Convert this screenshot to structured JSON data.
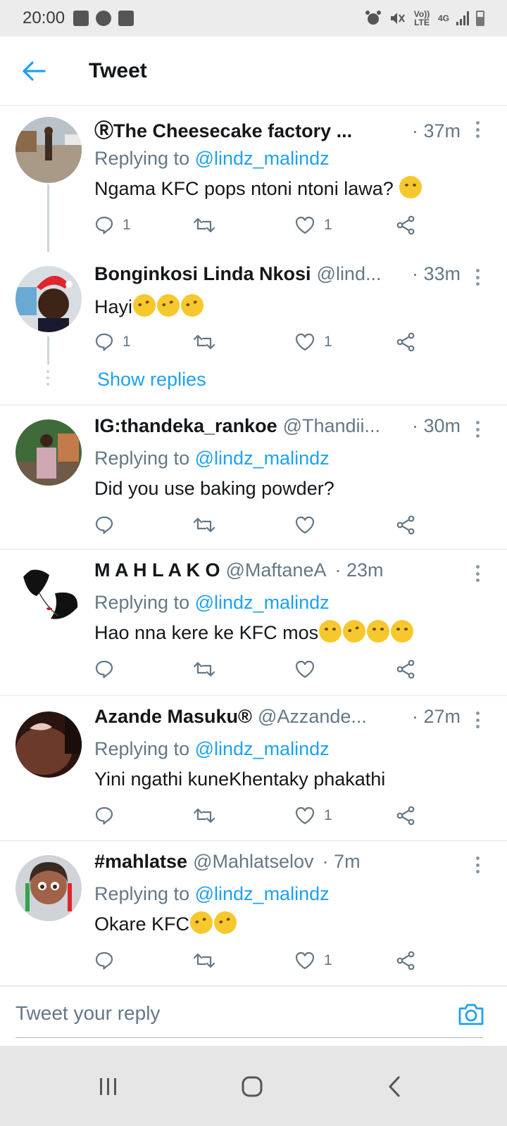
{
  "status_bar": {
    "time": "20:00",
    "volte": "Vo)) LTE",
    "network": "4G"
  },
  "header": {
    "title": "Tweet"
  },
  "tweets": [
    {
      "name": "ⓇThe Cheesecake factory ...",
      "handle": "",
      "time": "· 37m",
      "replying_label": "Replying to",
      "mention": "@lindz_malindz",
      "text": "Ngama KFC pops ntoni ntoni lawa?",
      "reply_count": "1",
      "retweet_count": "",
      "like_count": "1"
    },
    {
      "name": "Bonginkosi Linda Nkosi",
      "handle": "@lind...",
      "time": "· 33m",
      "text": "Hayi",
      "reply_count": "1",
      "retweet_count": "",
      "like_count": "1",
      "show_replies": "Show replies"
    },
    {
      "name": "IG:thandeka_rankoe",
      "handle": "@Thandii...",
      "time": "· 30m",
      "replying_label": "Replying to",
      "mention": "@lindz_malindz",
      "text": "Did you use baking powder?",
      "reply_count": "",
      "retweet_count": "",
      "like_count": ""
    },
    {
      "name": "M A H L A K O",
      "handle": "@MaftaneA",
      "time": "· 23m",
      "replying_label": "Replying to",
      "mention": "@lindz_malindz",
      "text": "Hao nna kere ke KFC mos",
      "reply_count": "",
      "retweet_count": "",
      "like_count": ""
    },
    {
      "name": "Azande Masuku®",
      "handle": "@Azzande...",
      "time": "· 27m",
      "replying_label": "Replying to",
      "mention": "@lindz_malindz",
      "text": "Yini ngathi kuneKhentaky phakathi",
      "reply_count": "",
      "retweet_count": "",
      "like_count": "1"
    },
    {
      "name": "#mahlatse",
      "handle": "@Mahlatselov",
      "time": "· 7m",
      "replying_label": "Replying to",
      "mention": "@lindz_malindz",
      "text": "Okare KFC",
      "reply_count": "",
      "retweet_count": "",
      "like_count": "1"
    }
  ],
  "reply_bar": {
    "placeholder": "Tweet your reply"
  },
  "icons": {
    "accent": "#1da1f2",
    "muted": "#657786"
  }
}
